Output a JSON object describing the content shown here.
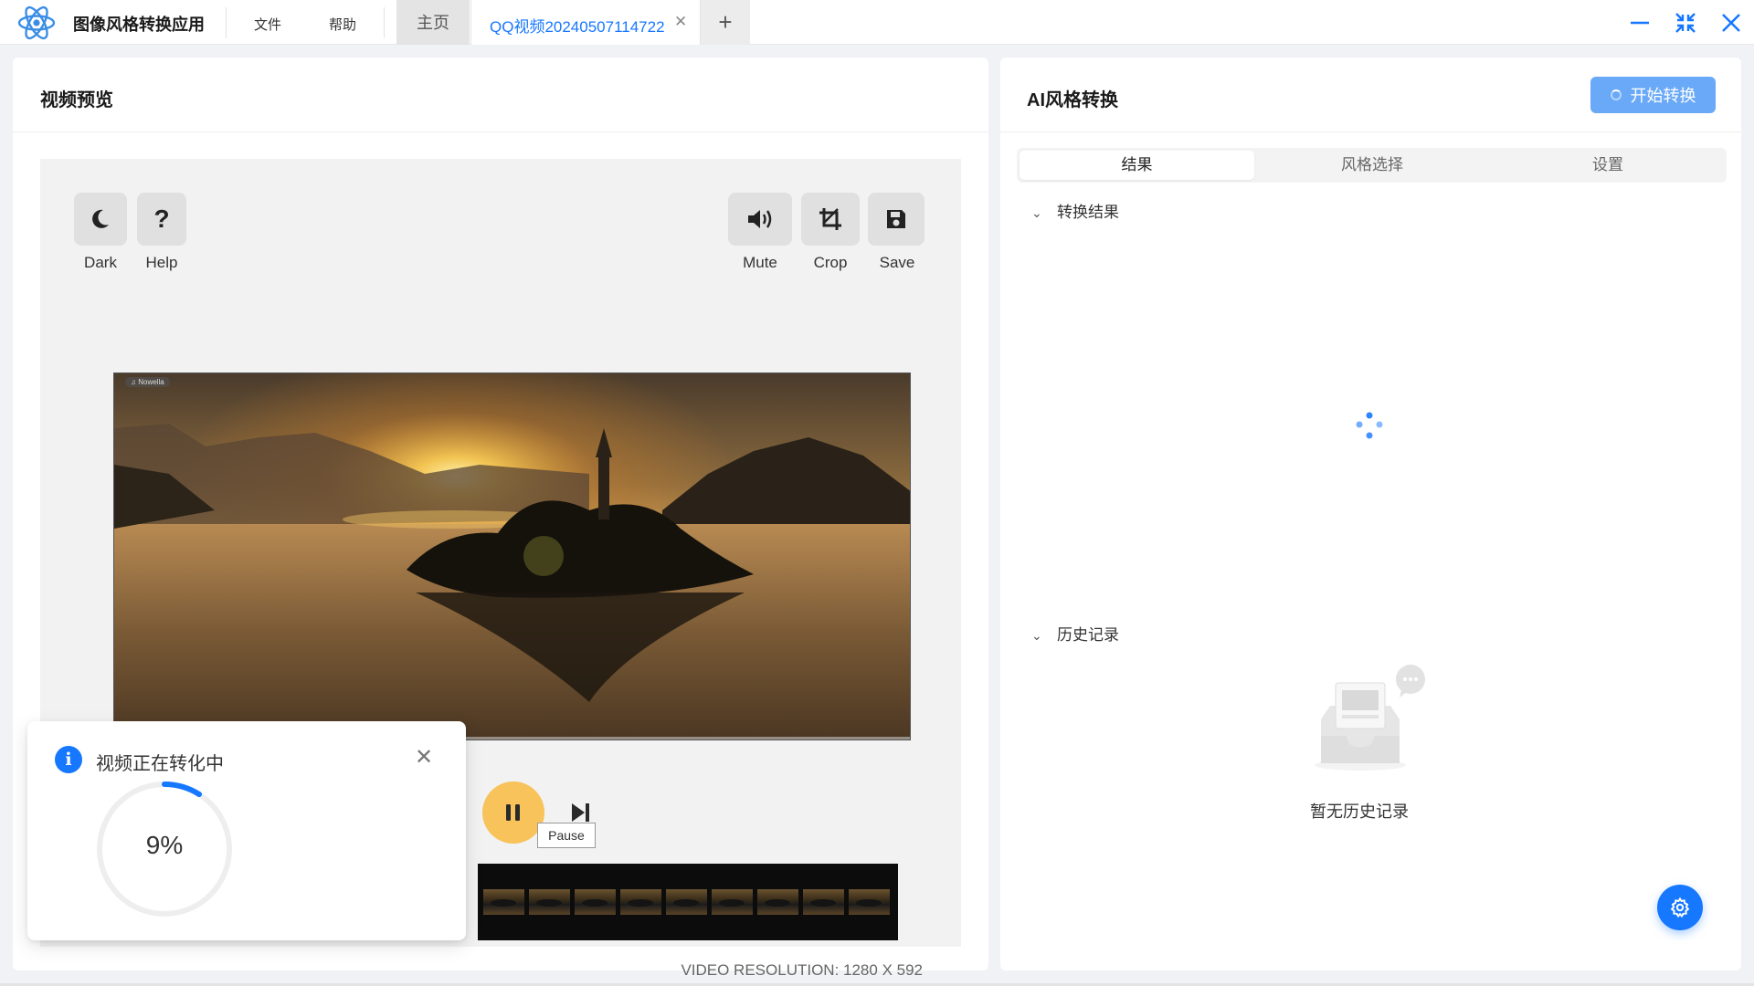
{
  "app": {
    "title": "图像风格转换应用",
    "menu": [
      "文件",
      "帮助"
    ],
    "tabs": {
      "home": "主页",
      "active": "QQ视频20240507114722",
      "add": "+"
    }
  },
  "left_panel": {
    "title": "视频预览",
    "tools_left": [
      {
        "label": "Dark",
        "icon": "moon-icon"
      },
      {
        "label": "Help",
        "icon": "question-icon"
      }
    ],
    "tools_right": [
      {
        "label": "Mute",
        "icon": "speaker-icon"
      },
      {
        "label": "Crop",
        "icon": "crop-icon"
      },
      {
        "label": "Save",
        "icon": "floppy-icon"
      }
    ],
    "video_badge": "♫ Nowella",
    "tooltip": "Pause",
    "resolution": "VIDEO RESOLUTION: 1280 X 592"
  },
  "notification": {
    "text": "视频正在转化中",
    "progress_label": "9%",
    "progress_fraction": 0.09
  },
  "right_panel": {
    "title": "AI风格转换",
    "start_button": "开始转换",
    "tabs": [
      "结果",
      "风格选择",
      "设置"
    ],
    "active_tab": 0,
    "section_result": "转换结果",
    "section_history": "历史记录",
    "empty_history": "暂无历史记录"
  },
  "colors": {
    "accent": "#1677ff",
    "play_button": "#f7c35a",
    "start_button": "#69a9f7"
  }
}
